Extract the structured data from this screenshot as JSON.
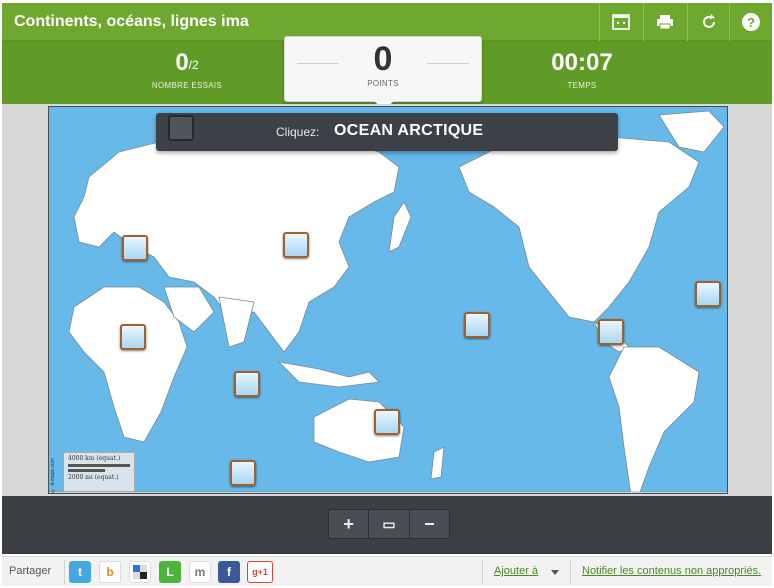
{
  "header": {
    "title": "Continents, océans, lignes ima",
    "icons": [
      "fullscreen-icon",
      "print-icon",
      "restart-icon",
      "help-icon"
    ]
  },
  "stats": {
    "attempts_value": "0",
    "attempts_total": "/2",
    "attempts_label": "NOMBRE ESSAIS",
    "points_value": "0",
    "points_label": "POINTS",
    "time_value": "00:07",
    "time_label": "TEMPS"
  },
  "prompt": {
    "label": "Cliquez:",
    "target": "OCEAN ARCTIQUE"
  },
  "map": {
    "scale_km": "4000 km (equat.)",
    "scale_mi": "2000 mi (equat.)",
    "credit": "© d-maps.com",
    "markers": 12,
    "colors": {
      "ocean": "#66b9e8",
      "land": "#ffffff",
      "marker_border": "#a0612a"
    }
  },
  "zoom": {
    "zoom_in": "+",
    "reset": "▭",
    "zoom_out": "−"
  },
  "share": {
    "label": "Partager",
    "services": [
      "twitter-icon",
      "blogger-icon",
      "delicious-icon",
      "live-icon",
      "myspace-icon",
      "facebook-icon",
      "google-plus-icon"
    ],
    "gplus_text": "g+1",
    "add_to": "Ajouter à",
    "report": "Notifier les contenus non appropriés."
  },
  "colors": {
    "header_green": "#6fa82f",
    "score_green": "#5f9b26",
    "dark_bar": "#3b3e43"
  }
}
